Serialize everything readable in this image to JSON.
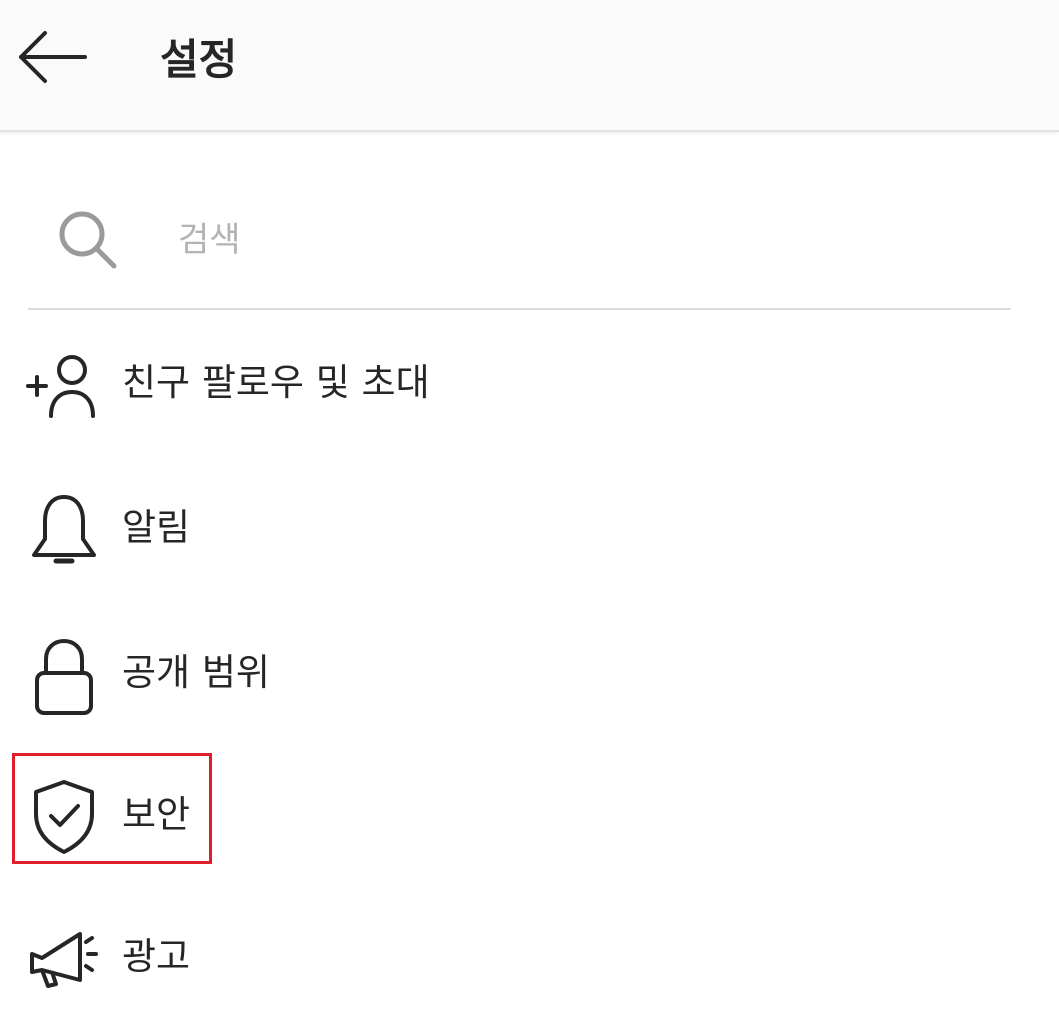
{
  "header": {
    "title": "설정",
    "back_icon": "arrow-left-icon"
  },
  "search": {
    "placeholder": "검색",
    "value": "",
    "icon": "search-icon"
  },
  "menu": {
    "items": [
      {
        "label": "친구 팔로우 및 초대",
        "icon": "add-person-icon"
      },
      {
        "label": "알림",
        "icon": "bell-icon"
      },
      {
        "label": "공개 범위",
        "icon": "lock-icon"
      },
      {
        "label": "보안",
        "icon": "shield-check-icon"
      },
      {
        "label": "광고",
        "icon": "megaphone-icon"
      }
    ]
  },
  "colors": {
    "header_bg": "#fafafa",
    "text": "#262626",
    "placeholder": "#b3b3b3",
    "divider": "#dbdbdb",
    "highlight": "#e0202a"
  }
}
